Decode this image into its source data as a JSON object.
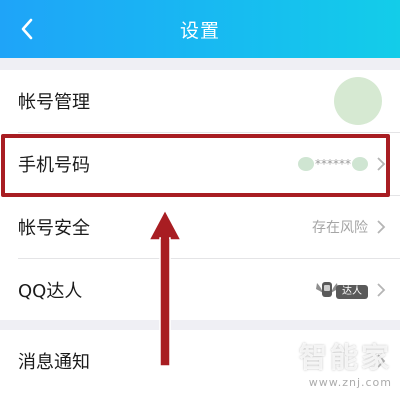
{
  "header": {
    "title": "设置",
    "back_icon": "chevron-left-icon",
    "background_colors": [
      "#1fa4f8",
      "#13cde9"
    ]
  },
  "settings": {
    "items": [
      {
        "label": "帐号管理"
      },
      {
        "label": "手机号码",
        "value_masked": "******"
      },
      {
        "label": "帐号安全",
        "value": "存在风险"
      },
      {
        "label": "QQ达人",
        "badge_text": "达人"
      },
      {
        "label": "消息通知"
      }
    ]
  },
  "annotation": {
    "highlight_color": "#a81d22"
  },
  "watermark": {
    "brand": "智能家",
    "url": "www.znj.com"
  }
}
